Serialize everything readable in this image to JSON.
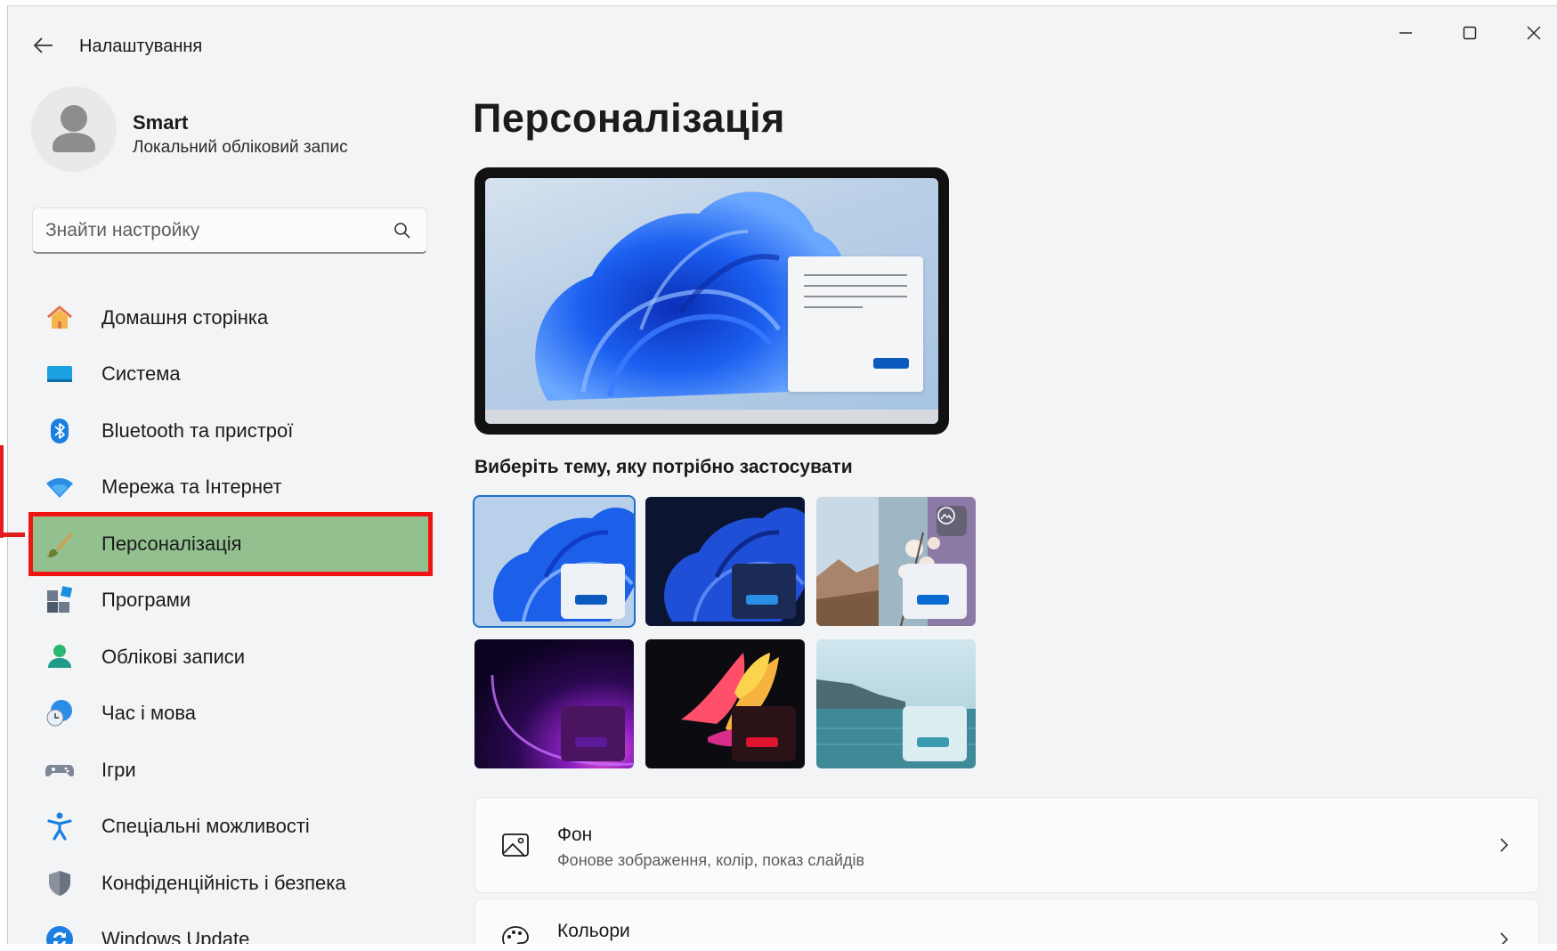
{
  "window": {
    "title": "Налаштування",
    "controls": {
      "minimize_icon": "minimize-icon",
      "maximize_icon": "maximize-icon",
      "close_icon": "close-icon"
    }
  },
  "user": {
    "name": "Smart",
    "account_type": "Локальний обліковий запис"
  },
  "search": {
    "placeholder": "Знайти настройку",
    "value": ""
  },
  "sidebar": {
    "items": [
      {
        "label": "Домашня сторінка",
        "icon": "home-icon"
      },
      {
        "label": "Система",
        "icon": "system-monitor-icon"
      },
      {
        "label": "Bluetooth та пристрої",
        "icon": "bluetooth-icon"
      },
      {
        "label": "Мережа та Інтернет",
        "icon": "wifi-icon"
      },
      {
        "label": "Персоналізація",
        "icon": "brush-icon",
        "selected": true
      },
      {
        "label": "Програми",
        "icon": "apps-icon"
      },
      {
        "label": "Облікові записи",
        "icon": "accounts-icon"
      },
      {
        "label": "Час і мова",
        "icon": "time-language-icon"
      },
      {
        "label": "Ігри",
        "icon": "gamepad-icon"
      },
      {
        "label": "Спеціальні можливості",
        "icon": "accessibility-icon"
      },
      {
        "label": "Конфіденційність і безпека",
        "icon": "shield-icon"
      },
      {
        "label": "Windows Update",
        "icon": "update-icon"
      }
    ]
  },
  "main": {
    "title": "Персоналізація",
    "theme_section_title": "Виберіть тему, яку потрібно застосувати",
    "themes": [
      {
        "name": "windows-light",
        "selected": true
      },
      {
        "name": "windows-dark",
        "selected": false
      },
      {
        "name": "spotlight",
        "selected": false
      },
      {
        "name": "glow",
        "selected": false
      },
      {
        "name": "captured-motion",
        "selected": false
      },
      {
        "name": "flow",
        "selected": false
      }
    ],
    "cards": [
      {
        "title": "Фон",
        "subtitle": "Фонове зображення, колір, показ слайдів",
        "icon": "image-icon"
      },
      {
        "title": "Кольори",
        "subtitle": "",
        "icon": "palette-icon"
      }
    ]
  },
  "colors": {
    "accent": "#0a5bbd",
    "highlight": "#93c08f",
    "annotation_red": "#f01313"
  }
}
